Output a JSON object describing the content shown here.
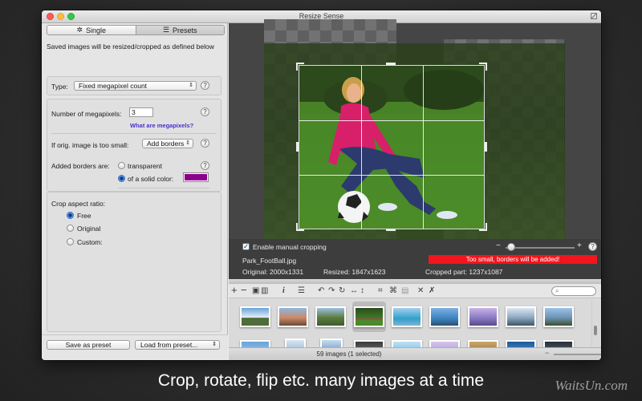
{
  "window": {
    "title": "Resize Sense"
  },
  "mode_tabs": [
    {
      "label": "Single",
      "icon": "gear-icon",
      "active": false
    },
    {
      "label": "Presets",
      "icon": "list-icon",
      "active": true
    }
  ],
  "left_panel": {
    "intro": "Saved images will be resized/cropped as defined below",
    "type_label": "Type:",
    "type_value": "Fixed megapixel count",
    "megapixels_label": "Number of megapixels:",
    "megapixels_value": "3",
    "megapixels_link": "What are megapixels?",
    "too_small_label": "If orig. image is too small:",
    "too_small_value": "Add borders",
    "borders_label": "Added borders are:",
    "border_options": [
      "transparent",
      "of a solid color:"
    ],
    "border_selected": "of a solid color:",
    "border_color": "#8b008b",
    "aspect_label": "Crop aspect ratio:",
    "aspect_options": [
      "Free",
      "Original",
      "Custom:"
    ],
    "aspect_selected": "Free",
    "save_preset": "Save as preset",
    "load_preset": "Load from preset..."
  },
  "preview": {
    "enable_cropping_label": "Enable manual cropping",
    "enable_cropping_checked": true,
    "file_name": "Park_FootBall.jpg",
    "original": "Original: 2000x1331",
    "resized": "Resized: 1847x1623",
    "cropped": "Cropped part: 1237x1087",
    "warning": "Too small, borders will be added!",
    "warning_color": "#f2151d",
    "zoom_minus": "−",
    "zoom_plus": "+"
  },
  "toolbar": {
    "icons": [
      "add-icon",
      "remove-icon",
      "save-icon",
      "trash-icon",
      "info-icon",
      "list-icon",
      "rotate-left-icon",
      "rotate-right-icon",
      "rotate-icon",
      "flip-horizontal-icon",
      "flip-vertical-icon",
      "crop-icon",
      "auto-crop-icon",
      "paste-icon",
      "close-icon",
      "clear-icon"
    ],
    "search_icon": "search-icon"
  },
  "thumbnails": {
    "count_selected": "59 images (1 selected)",
    "selected_index": 3
  },
  "caption": "Crop, rotate, flip etc. many images at a time",
  "watermark": "WaitsUn.com"
}
